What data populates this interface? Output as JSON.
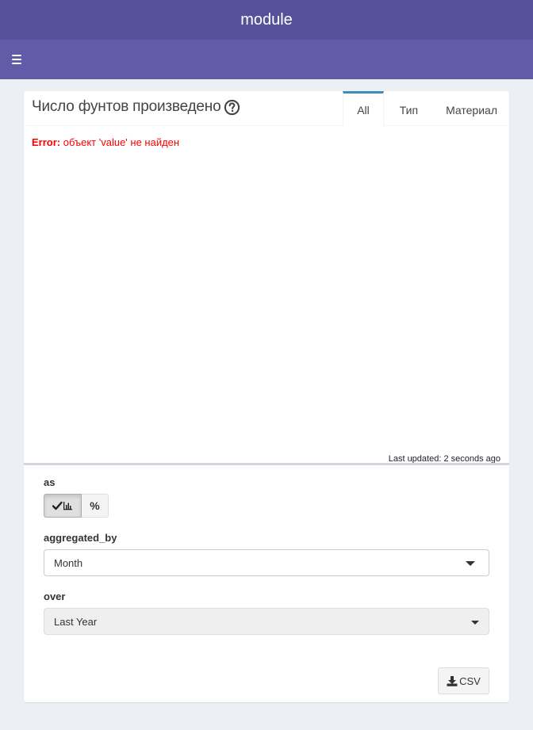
{
  "header": {
    "title": "module"
  },
  "navbar": {
    "menu_icon": "hamburger-icon"
  },
  "box": {
    "title": "Число фунтов произведено",
    "help_icon": "question-circle-icon",
    "tabs": [
      {
        "label": "All",
        "active": true
      },
      {
        "label": "Тип",
        "active": false
      },
      {
        "label": "Материал",
        "active": false
      }
    ],
    "error": {
      "prefix": "Error:",
      "message": " объект 'value' не найден"
    },
    "last_updated": "Last updated: 2 seconds ago"
  },
  "controls": {
    "as": {
      "label": "as",
      "options": [
        {
          "icon": "check-bar-chart-icon",
          "selected": true
        },
        {
          "icon": "percent-icon",
          "text": "%",
          "selected": false
        }
      ]
    },
    "aggregated_by": {
      "label": "aggregated_by",
      "value": "Month"
    },
    "over": {
      "label": "over",
      "value": "Last Year"
    },
    "csv_button": {
      "label": "CSV",
      "icon": "download-icon"
    }
  },
  "colors": {
    "header_bg": "#555299",
    "navbar_bg": "#605ca8",
    "tab_active_border": "#3c8dbc",
    "error": "#ff0000"
  }
}
